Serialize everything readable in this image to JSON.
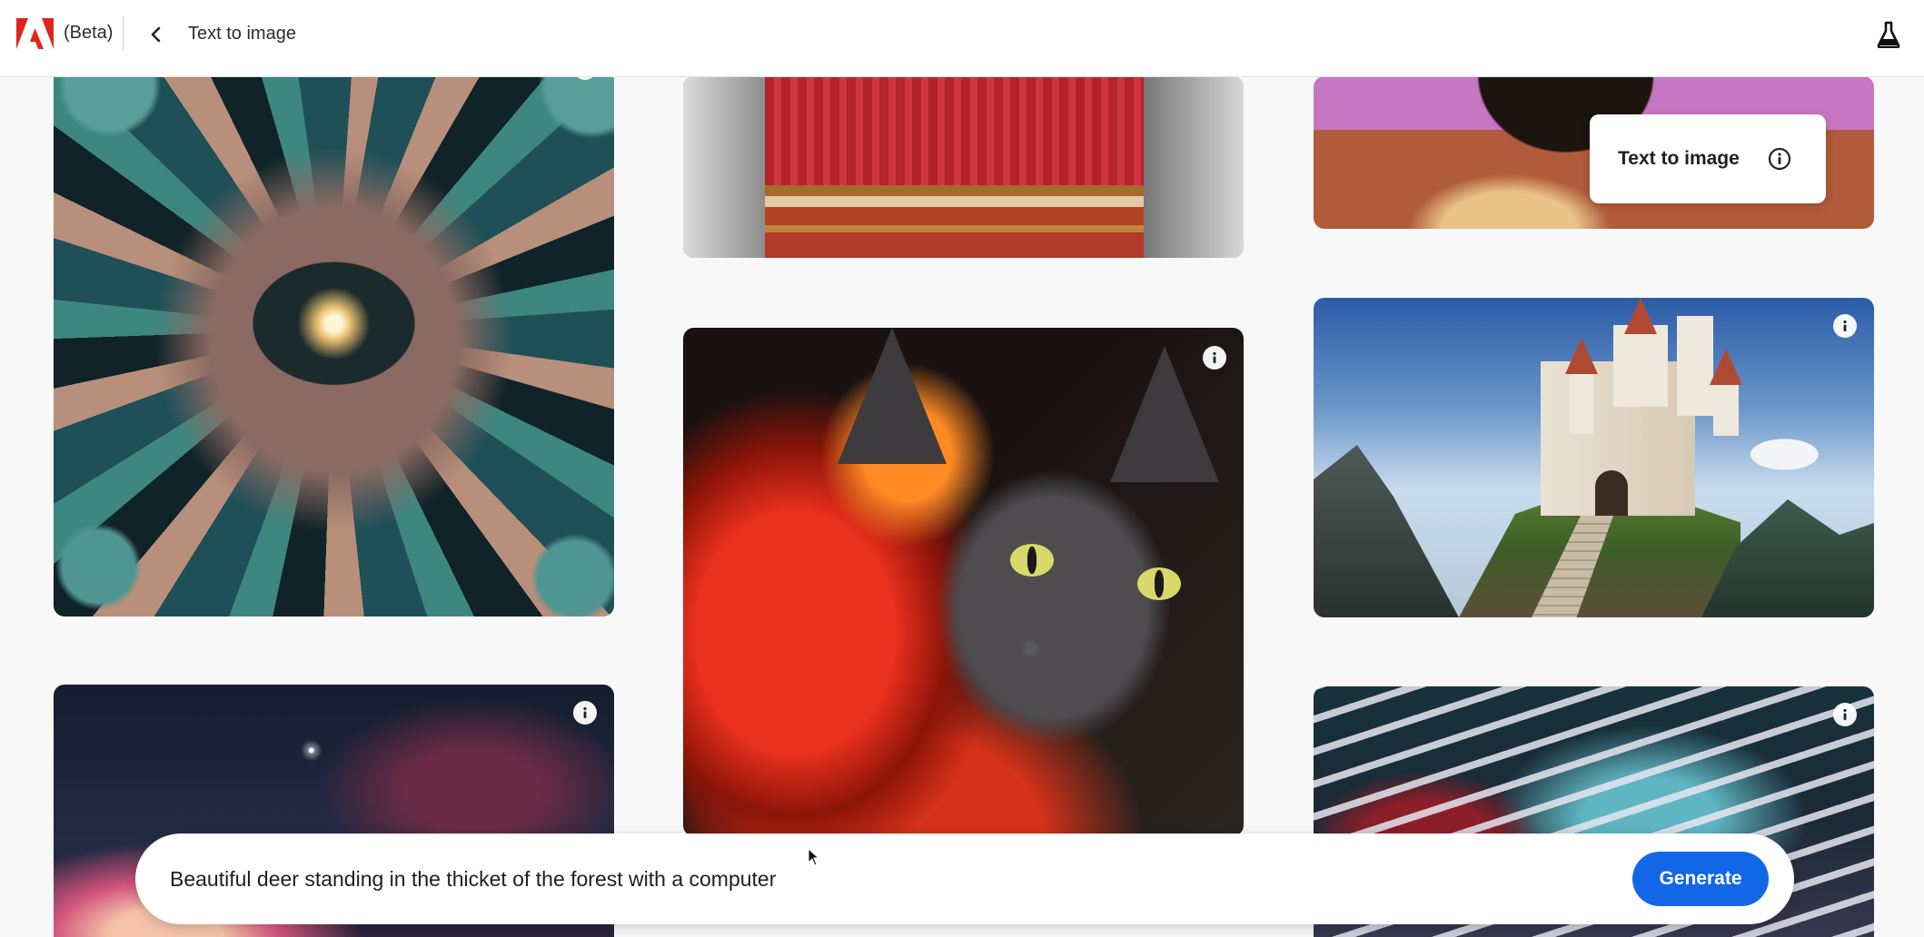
{
  "header": {
    "beta_label": "(Beta)",
    "page_title": "Text to image"
  },
  "tooltip": {
    "label": "Text to image"
  },
  "gallery": {
    "items": [
      {
        "subject": "fractal"
      },
      {
        "subject": "knit sweater"
      },
      {
        "subject": "illustrated figure"
      },
      {
        "subject": "fire cat"
      },
      {
        "subject": "castle on cliff"
      },
      {
        "subject": "night sky with flower"
      },
      {
        "subject": "broken piano"
      }
    ]
  },
  "prompt": {
    "value": "Beautiful deer standing in the thicket of the forest with a computer",
    "generate_label": "Generate"
  },
  "colors": {
    "accent": "#1167e6",
    "brand": "#e1251b",
    "background": "#f8f8f9"
  }
}
